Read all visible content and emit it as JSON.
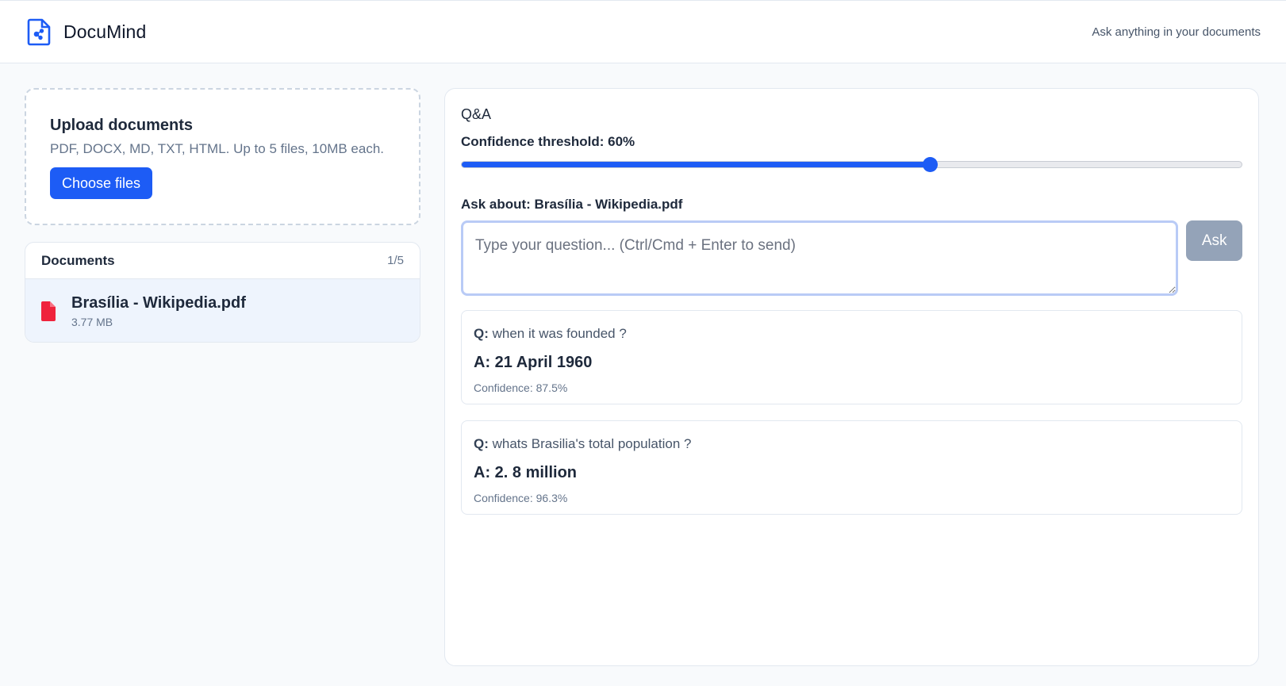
{
  "header": {
    "app_name": "DocuMind",
    "tagline": "Ask anything in your documents",
    "logo_icon": "document-sparkle-icon"
  },
  "upload": {
    "title": "Upload documents",
    "hint": "PDF, DOCX, MD, TXT, HTML. Up to 5 files, 10MB each.",
    "button_label": "Choose files"
  },
  "documents": {
    "title": "Documents",
    "count": "1/5",
    "items": [
      {
        "name": "Brasília - Wikipedia.pdf",
        "size": "3.77 MB",
        "icon": "pdf-file-icon"
      }
    ]
  },
  "qa": {
    "title": "Q&A",
    "confidence_label": "Confidence threshold: 60%",
    "confidence_threshold": 0.6,
    "ask_about_label": "Ask about: Brasília - Wikipedia.pdf",
    "input_placeholder": "Type your question... (Ctrl/Cmd + Enter to send)",
    "input_value": "",
    "ask_button_label": "Ask",
    "answers": [
      {
        "q_prefix": "Q:",
        "question": "when it was founded ?",
        "answer": "A: 21 April 1960",
        "confidence": "Confidence: 87.5%"
      },
      {
        "q_prefix": "Q:",
        "question": "whats Brasilia's total population ?",
        "answer": "A: 2. 8 million",
        "confidence": "Confidence: 96.3%"
      }
    ]
  },
  "colors": {
    "accent": "#1d5cf5",
    "pdf_icon": "#ef233c",
    "disabled_button": "#94a3b8",
    "selected_row": "#eef4fd"
  }
}
